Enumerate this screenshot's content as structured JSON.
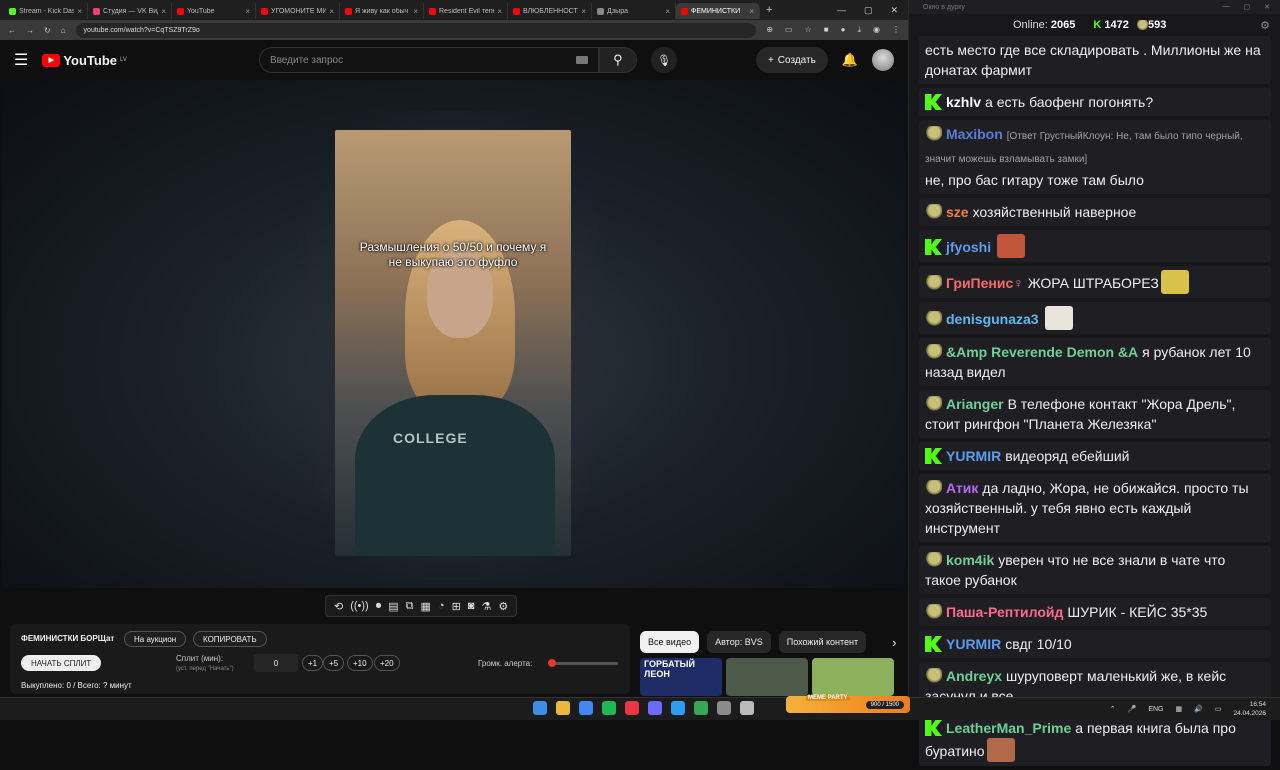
{
  "browser": {
    "tabs": [
      {
        "label": "Stream - Kick Dash",
        "color": "#53fc18",
        "active": false
      },
      {
        "label": "Студия — VK Вид",
        "color": "#ff3f6e",
        "active": false
      },
      {
        "label": "YouTube",
        "color": "#ff0000",
        "active": false
      },
      {
        "label": "УГОМОНИТЕ МИ",
        "color": "#ff0000",
        "active": false
      },
      {
        "label": "Я живу как обыч",
        "color": "#ff0000",
        "active": false
      },
      {
        "label": "Resident Evil тепе",
        "color": "#ff0000",
        "active": false
      },
      {
        "label": "ВЛЮБЛЕННОСТЬ",
        "color": "#ff0000",
        "active": false
      },
      {
        "label": "Дзыра",
        "color": "#888888",
        "active": false
      },
      {
        "label": "ФЕМИНИСТКИ",
        "color": "#ff0000",
        "active": true
      }
    ],
    "new_tab": "+",
    "url": "youtube.com/watch?v=CqTSZ9TrZ9o"
  },
  "youtube": {
    "logo_text": "YouTube",
    "logo_region": "LV",
    "search_placeholder": "Введите запрос",
    "create_label": "Создать",
    "video_caption": "Размышления о 50/50 и почему я не выкупаю это фуфло",
    "shirt_text": "COLLEGE",
    "player_controls": [
      "loop-icon",
      "broadcast-icon",
      "screen-record-icon",
      "clip-icon",
      "pip-icon",
      "subtitles-icon",
      "speed-icon",
      "frame-icon",
      "screenshot-icon",
      "lab-icon",
      "settings-icon"
    ]
  },
  "split_panel": {
    "title": "ФЕМИНИСТКИ БОРЩат",
    "auction_label": "На аукцион",
    "copy_label": "КОПИРОВАТЬ",
    "start_label": "НАЧАТЬ СПЛИТ",
    "split_label": "Сплит (мин):",
    "split_hint": "(уст. перед \"Начать\")",
    "split_value": "0",
    "increments": [
      "+1",
      "+5",
      "+10",
      "+20"
    ],
    "alert_volume_label": "Громк. алерта:",
    "alert_volume": 0.05,
    "status": "Выкуплено: 0 / Всего: ? минут"
  },
  "filters": {
    "chips": [
      "Все видео",
      "Автор: BVS",
      "Похожий контент"
    ],
    "next": "›"
  },
  "thumbs": [
    {
      "title": "ГОРБАТЫЙ ЛЕОН",
      "color": "#1e2d66"
    },
    {
      "title": "",
      "color": "#4d5a4a"
    },
    {
      "title": "",
      "color": "#8db05c"
    }
  ],
  "chat": {
    "window_title": "Окно в дурку",
    "online_label": "Online:",
    "online": "2065",
    "kick_count": "1472",
    "other_count": "593",
    "messages": [
      {
        "badge": "none",
        "user": "",
        "color": "#ffffff",
        "text": "есть место где все складировать . Миллионы же на донатах фармит",
        "reply": ""
      },
      {
        "badge": "k",
        "user": "kzhlv",
        "color": "#ffffff",
        "text": "а есть баофенг погонять?",
        "reply": ""
      },
      {
        "badge": "s",
        "user": "Maxibon",
        "color": "#5b7bd6",
        "text": "не, про бас гитару тоже там было",
        "reply": "[Ответ ГрустныйКлоун: Не, там было типо черный, значит можешь взламывать замки]"
      },
      {
        "badge": "s",
        "user": "sze",
        "color": "#f0803c",
        "text": "хозяйственный наверное",
        "reply": ""
      },
      {
        "badge": "k",
        "user": "jfyoshi",
        "color": "#5b9bf0",
        "text": "",
        "reply": "",
        "emote": "#c2563a"
      },
      {
        "badge": "s",
        "user": "ГриПенис♀",
        "color": "#ff6b6b",
        "text": "ЖОРА ШТРАБОРЕЗ",
        "reply": "",
        "emote": "#d9c24a"
      },
      {
        "badge": "s",
        "user": "denisgunaza3",
        "color": "#5bb8f0",
        "text": "",
        "reply": "",
        "emote": "#e8e4dc"
      },
      {
        "badge": "s",
        "user": "&Amp Reverende Demon &A",
        "color": "#6fcf97",
        "text": "я рубанок лет 10 назад видел",
        "reply": ""
      },
      {
        "badge": "s",
        "user": "Arianger",
        "color": "#6fcf97",
        "text": "В телефоне контакт \"Жора Дрель\", стоит рингфон \"Планета Железяка\"",
        "reply": ""
      },
      {
        "badge": "k",
        "user": "YURMIR",
        "color": "#5b9bf0",
        "text": "видеоряд ебейший",
        "reply": ""
      },
      {
        "badge": "s",
        "user": "Атик",
        "color": "#b56bf0",
        "text": "да ладно, Жора, не обижайся. просто ты хозяйственный. у тебя явно есть каждый инструмент",
        "reply": ""
      },
      {
        "badge": "s",
        "user": "kom4ik",
        "color": "#6fcf97",
        "text": "уверен что не все знали в чате что такое рубанок",
        "reply": ""
      },
      {
        "badge": "s",
        "user": "Паша-Рептилойд",
        "color": "#ff6b8a",
        "text": "ШУРИК - КЕЙС 35*35",
        "reply": ""
      },
      {
        "badge": "k",
        "user": "YURMIR",
        "color": "#5b9bf0",
        "text": "свдг 10/10",
        "reply": ""
      },
      {
        "badge": "s",
        "user": "Andreyx",
        "color": "#6fcf97",
        "text": "шуруповерт маленький же, в кейс засунул и все",
        "reply": ""
      },
      {
        "badge": "k",
        "user": "LeatherMan_Prime",
        "color": "#6fcf97",
        "text": "а первая книга была про буратино",
        "reply": "",
        "emote": "#b06a4a"
      }
    ]
  },
  "taskbar": {
    "meme_label": "MEME PARTY",
    "meme_progress": "900 / 1500",
    "lang": "ENG",
    "time": "16:54",
    "date": "24.04.2026"
  }
}
